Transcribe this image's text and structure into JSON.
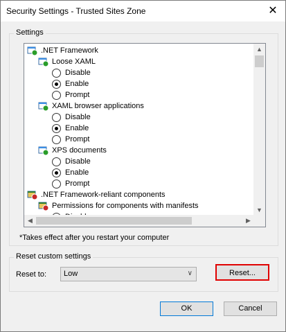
{
  "window": {
    "title": "Security Settings - Trusted Sites Zone"
  },
  "settings": {
    "group_label": "Settings",
    "items": [
      {
        "label": ".NET Framework",
        "type": "category",
        "icon": "settings-folder-icon"
      },
      {
        "label": "Loose XAML",
        "type": "setting",
        "icon": "settings-item-icon"
      },
      {
        "label": "Disable",
        "type": "radio",
        "checked": false
      },
      {
        "label": "Enable",
        "type": "radio",
        "checked": true
      },
      {
        "label": "Prompt",
        "type": "radio",
        "checked": false
      },
      {
        "label": "XAML browser applications",
        "type": "setting",
        "icon": "settings-item-icon"
      },
      {
        "label": "Disable",
        "type": "radio",
        "checked": false
      },
      {
        "label": "Enable",
        "type": "radio",
        "checked": true
      },
      {
        "label": "Prompt",
        "type": "radio",
        "checked": false
      },
      {
        "label": "XPS documents",
        "type": "setting",
        "icon": "settings-item-icon"
      },
      {
        "label": "Disable",
        "type": "radio",
        "checked": false
      },
      {
        "label": "Enable",
        "type": "radio",
        "checked": true
      },
      {
        "label": "Prompt",
        "type": "radio",
        "checked": false
      },
      {
        "label": ".NET Framework-reliant components",
        "type": "category",
        "icon": "component-folder-icon"
      },
      {
        "label": "Permissions for components with manifests",
        "type": "setting",
        "icon": "component-item-icon"
      },
      {
        "label": "Disable",
        "type": "radio",
        "checked": false
      }
    ],
    "note": "*Takes effect after you restart your computer"
  },
  "reset": {
    "group_label": "Reset custom settings",
    "reset_to_label": "Reset to:",
    "selected_level": "Low",
    "reset_button": "Reset..."
  },
  "buttons": {
    "ok": "OK",
    "cancel": "Cancel"
  },
  "colors": {
    "highlight": "#e00000",
    "default_button_border": "#0078d7"
  }
}
